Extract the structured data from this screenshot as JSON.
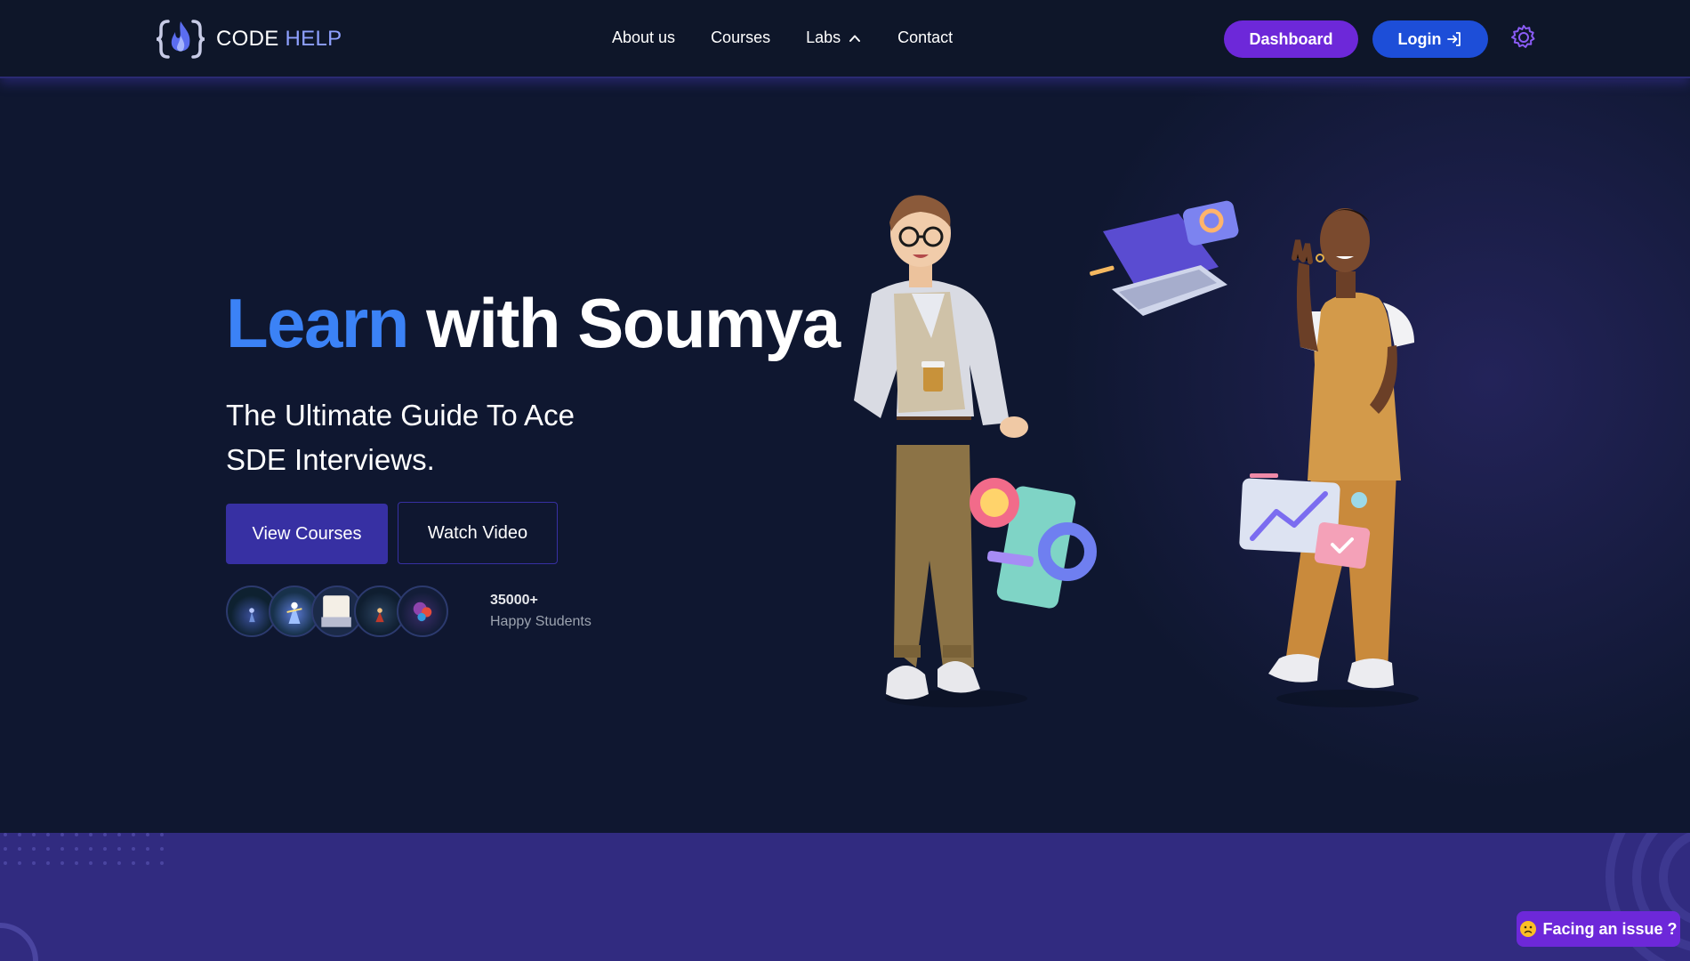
{
  "brand": {
    "part1": "CODE",
    "part2": "HELP",
    "accent": "#8ea0ff"
  },
  "nav": {
    "items": [
      {
        "label": "About us"
      },
      {
        "label": "Courses"
      },
      {
        "label": "Labs",
        "icon": "chevron-up-icon"
      },
      {
        "label": "Contact"
      }
    ],
    "dashboard_label": "Dashboard",
    "login_label": "Login",
    "settings_icon": "gear-icon"
  },
  "hero": {
    "title_accent": "Learn",
    "title_rest": "with Soumya",
    "subtitle": "The Ultimate Guide To Ace SDE Interviews.",
    "primary_cta": "View Courses",
    "secondary_cta": "Watch Video",
    "students_count": "35000+",
    "students_label": "Happy Students"
  },
  "feedback": {
    "label": "Facing an issue ?",
    "icon": "confused-face-icon"
  },
  "colors": {
    "background": "#0f1730",
    "title_accent": "#3b82f6",
    "dashboard_button": "#6d28d9",
    "login_button": "#1d4ed8",
    "primary_cta": "#3730a3",
    "band": "#312b80"
  }
}
